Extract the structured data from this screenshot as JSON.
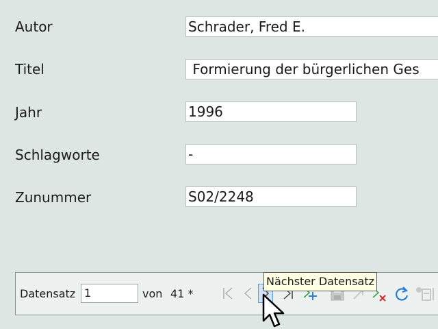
{
  "form": {
    "fields": [
      {
        "label": "Autor",
        "value": "Schrader, Fred E."
      },
      {
        "label": "Titel",
        "value": " Formierung der bürgerlichen Ges"
      },
      {
        "label": "Jahr",
        "value": "1996"
      },
      {
        "label": "Schlagworte",
        "value": "-"
      },
      {
        "label": "Zunummer",
        "value": "S02/2248"
      }
    ]
  },
  "navigation": {
    "record_label": "Datensatz",
    "record_value": "1",
    "of_label": "von",
    "total": "41 *",
    "tooltip": "Nächster Datensatz"
  },
  "icons": {
    "first": "first-record-icon",
    "previous": "previous-record-icon",
    "next": "next-record-icon",
    "last": "last-record-icon",
    "new": "new-record-icon",
    "save": "save-record-icon",
    "undo": "undo-icon",
    "cancel": "cancel-icon",
    "refresh": "refresh-icon",
    "more": "more-tools-icon"
  },
  "colors": {
    "background": "#dde6e3",
    "highlight": "#cfe2f7",
    "green": "#2ea043",
    "red": "#d42a2a",
    "blue": "#2a7fd4"
  }
}
